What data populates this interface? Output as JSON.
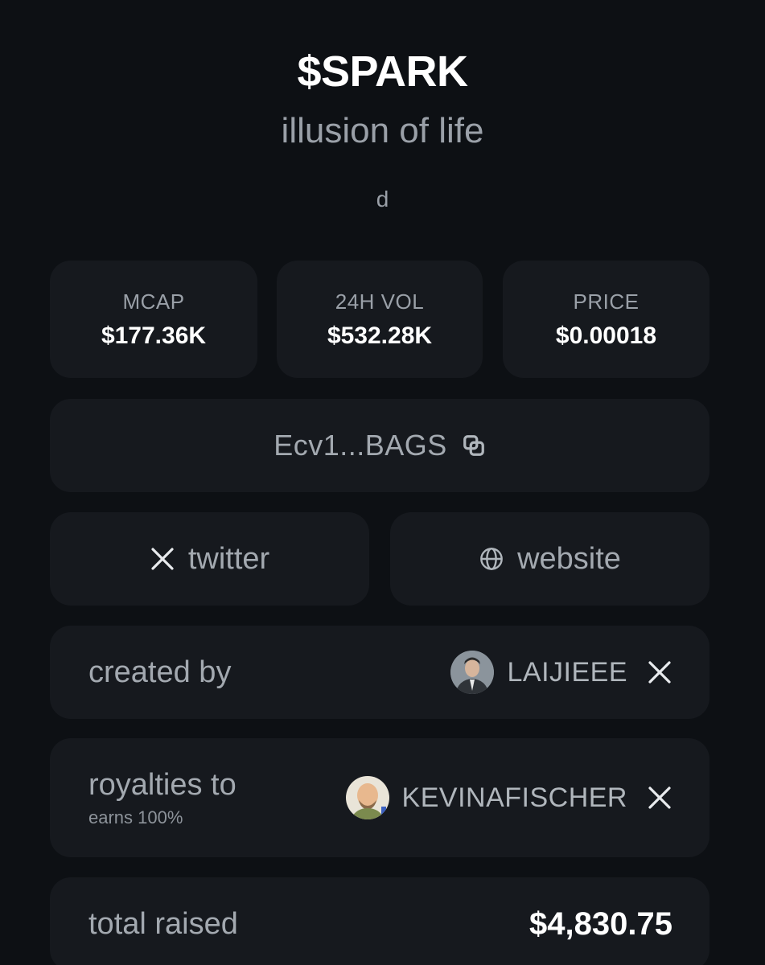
{
  "token": {
    "ticker": "$SPARK",
    "name": "illusion of life",
    "description": "d"
  },
  "stats": [
    {
      "label": "MCAP",
      "value": "$177.36K"
    },
    {
      "label": "24H VOL",
      "value": "$532.28K"
    },
    {
      "label": "PRICE",
      "value": "$0.00018"
    }
  ],
  "contract": {
    "address_short": "Ecv1...BAGS",
    "icon": "copy-icon"
  },
  "links": {
    "twitter_label": "twitter",
    "twitter_icon": "x-icon",
    "website_label": "website",
    "website_icon": "globe-icon"
  },
  "created_by": {
    "label": "created by",
    "username": "LAIJIEEE",
    "icon": "x-icon"
  },
  "royalties": {
    "label": "royalties to",
    "sub": "earns 100%",
    "username": "KEVINAFISCHER",
    "icon": "x-icon"
  },
  "total_raised": {
    "label": "total raised",
    "value": "$4,830.75"
  },
  "colors": {
    "background": "#0d1014",
    "card": "#16191e",
    "muted_text": "#9aa0a8",
    "primary_text": "#ffffff"
  }
}
